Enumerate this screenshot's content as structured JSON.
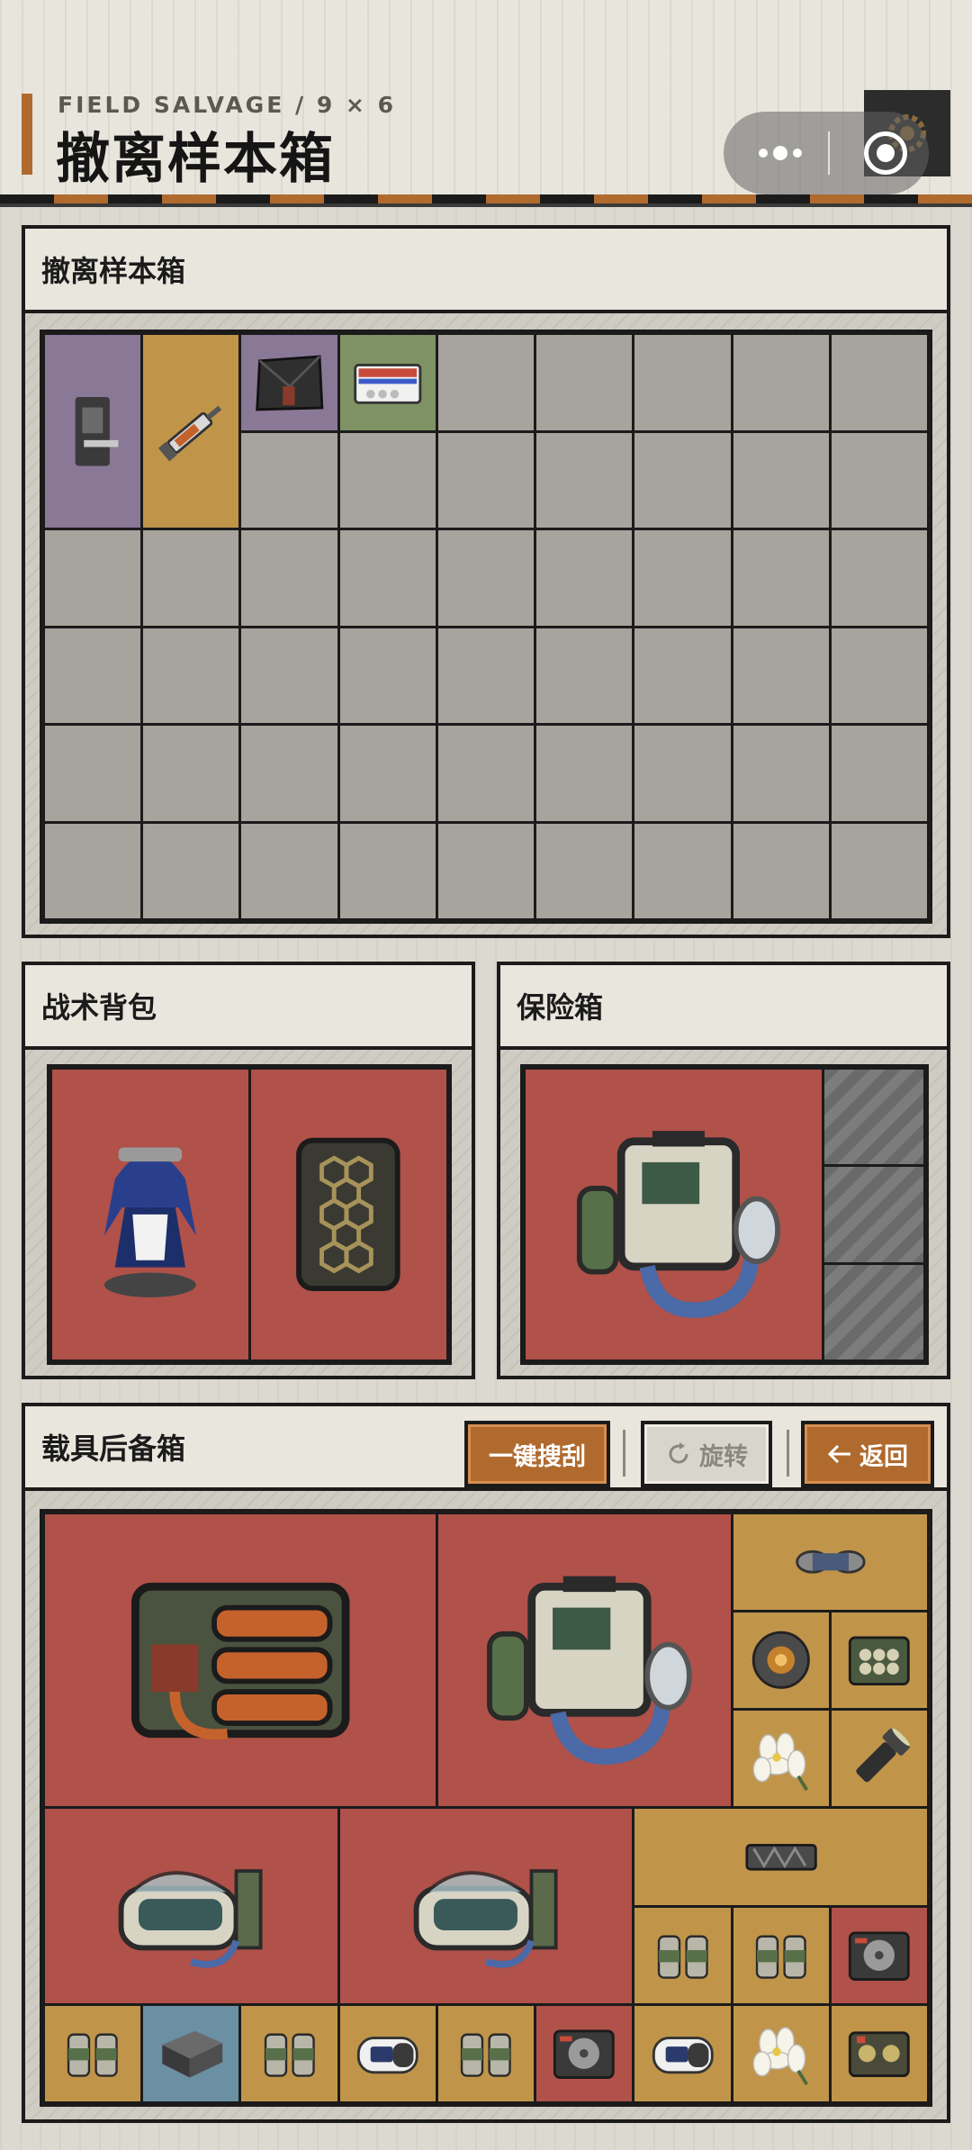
{
  "header": {
    "subtitle": "FIELD SALVAGE / 9 × 6",
    "title": "撤离样本箱",
    "capsule_icons": [
      "more-dots-icon",
      "target-icon"
    ],
    "settings_icon": "gear-icon"
  },
  "sample_box": {
    "title": "撤离样本箱",
    "cols": 9,
    "rows": 6,
    "items": [
      {
        "name": "door-lock-item",
        "icon": "door-lock-icon",
        "color": "purple",
        "col": 0,
        "row": 0,
        "w": 1,
        "h": 2
      },
      {
        "name": "syringe-item",
        "icon": "syringe-icon",
        "color": "gold",
        "col": 1,
        "row": 0,
        "w": 1,
        "h": 2
      },
      {
        "name": "tactical-pouch-item",
        "icon": "pouch-icon",
        "color": "purple",
        "col": 2,
        "row": 0,
        "w": 1,
        "h": 1
      },
      {
        "name": "pill-box-item",
        "icon": "pill-box-icon",
        "color": "green",
        "col": 3,
        "row": 0,
        "w": 1,
        "h": 1
      }
    ]
  },
  "backpack": {
    "title": "战术背包",
    "items": [
      {
        "name": "maid-figurine-item",
        "icon": "figurine-icon",
        "color": "red"
      },
      {
        "name": "armor-plate-item",
        "icon": "honeycomb-plate-icon",
        "color": "red"
      }
    ]
  },
  "safe_box": {
    "title": "保险箱",
    "items": [
      {
        "name": "oxygen-machine-item",
        "icon": "oxygen-machine-icon",
        "color": "red"
      }
    ],
    "locked_slots": 3
  },
  "vehicle_box": {
    "title": "载具后备箱",
    "buttons": {
      "loot_all": "一键搜刮",
      "rotate": "旋转",
      "back": "返回"
    },
    "button_icons": {
      "rotate": "rotate-icon",
      "back": "arrow-left-icon"
    },
    "cols": 9,
    "rows": 6,
    "items": [
      {
        "name": "battery-pack-item",
        "icon": "battery-pack-icon",
        "color": "red",
        "col": 0,
        "row": 0,
        "w": 4,
        "h": 3
      },
      {
        "name": "oxygen-machine-item",
        "icon": "oxygen-machine-icon",
        "color": "red",
        "col": 4,
        "row": 0,
        "w": 3,
        "h": 3
      },
      {
        "name": "tape-item",
        "icon": "tape-icon",
        "color": "gold",
        "col": 7,
        "row": 0,
        "w": 2,
        "h": 1
      },
      {
        "name": "reactor-core-item",
        "icon": "core-icon",
        "color": "gold",
        "col": 7,
        "row": 1,
        "w": 1,
        "h": 1
      },
      {
        "name": "ammo-case-item",
        "icon": "ammo-case-icon",
        "color": "gold",
        "col": 8,
        "row": 1,
        "w": 1,
        "h": 1
      },
      {
        "name": "flower-item",
        "icon": "flower-icon",
        "color": "gold",
        "col": 7,
        "row": 2,
        "w": 1,
        "h": 1
      },
      {
        "name": "flashlight-item",
        "icon": "flashlight-icon",
        "color": "gold",
        "col": 8,
        "row": 2,
        "w": 1,
        "h": 1
      },
      {
        "name": "medical-pod-item-1",
        "icon": "medical-pod-icon",
        "color": "red",
        "col": 0,
        "row": 3,
        "w": 3,
        "h": 2
      },
      {
        "name": "medical-pod-item-2",
        "icon": "medical-pod-icon",
        "color": "red",
        "col": 3,
        "row": 3,
        "w": 3,
        "h": 2
      },
      {
        "name": "rail-item",
        "icon": "rail-icon",
        "color": "gold",
        "col": 6,
        "row": 3,
        "w": 3,
        "h": 1
      },
      {
        "name": "canisters-item-1",
        "icon": "canisters-icon",
        "color": "gold",
        "col": 6,
        "row": 4,
        "w": 1,
        "h": 1
      },
      {
        "name": "canisters-item-2",
        "icon": "canisters-icon",
        "color": "gold",
        "col": 7,
        "row": 4,
        "w": 1,
        "h": 1
      },
      {
        "name": "hard-drive-item-1",
        "icon": "hard-drive-icon",
        "color": "red",
        "col": 8,
        "row": 4,
        "w": 1,
        "h": 1
      },
      {
        "name": "canisters-item-3",
        "icon": "canisters-icon",
        "color": "gold",
        "col": 0,
        "row": 5,
        "w": 1,
        "h": 1
      },
      {
        "name": "metal-block-item",
        "icon": "metal-block-icon",
        "color": "blue",
        "col": 1,
        "row": 5,
        "w": 1,
        "h": 1
      },
      {
        "name": "canisters-item-4",
        "icon": "canisters-icon",
        "color": "gold",
        "col": 2,
        "row": 5,
        "w": 1,
        "h": 1
      },
      {
        "name": "oximeter-item-1",
        "icon": "oximeter-icon",
        "color": "gold",
        "col": 3,
        "row": 5,
        "w": 1,
        "h": 1
      },
      {
        "name": "canisters-item-5",
        "icon": "canisters-icon",
        "color": "gold",
        "col": 4,
        "row": 5,
        "w": 1,
        "h": 1
      },
      {
        "name": "hard-drive-item-2",
        "icon": "hard-drive-icon",
        "color": "red",
        "col": 5,
        "row": 5,
        "w": 1,
        "h": 1
      },
      {
        "name": "oximeter-item-2",
        "icon": "oximeter-icon",
        "color": "gold",
        "col": 6,
        "row": 5,
        "w": 1,
        "h": 1
      },
      {
        "name": "flower-item-2",
        "icon": "flower-icon",
        "color": "gold",
        "col": 7,
        "row": 5,
        "w": 1,
        "h": 1
      },
      {
        "name": "tape-recorder-item",
        "icon": "recorder-icon",
        "color": "gold",
        "col": 8,
        "row": 5,
        "w": 1,
        "h": 1
      }
    ]
  }
}
